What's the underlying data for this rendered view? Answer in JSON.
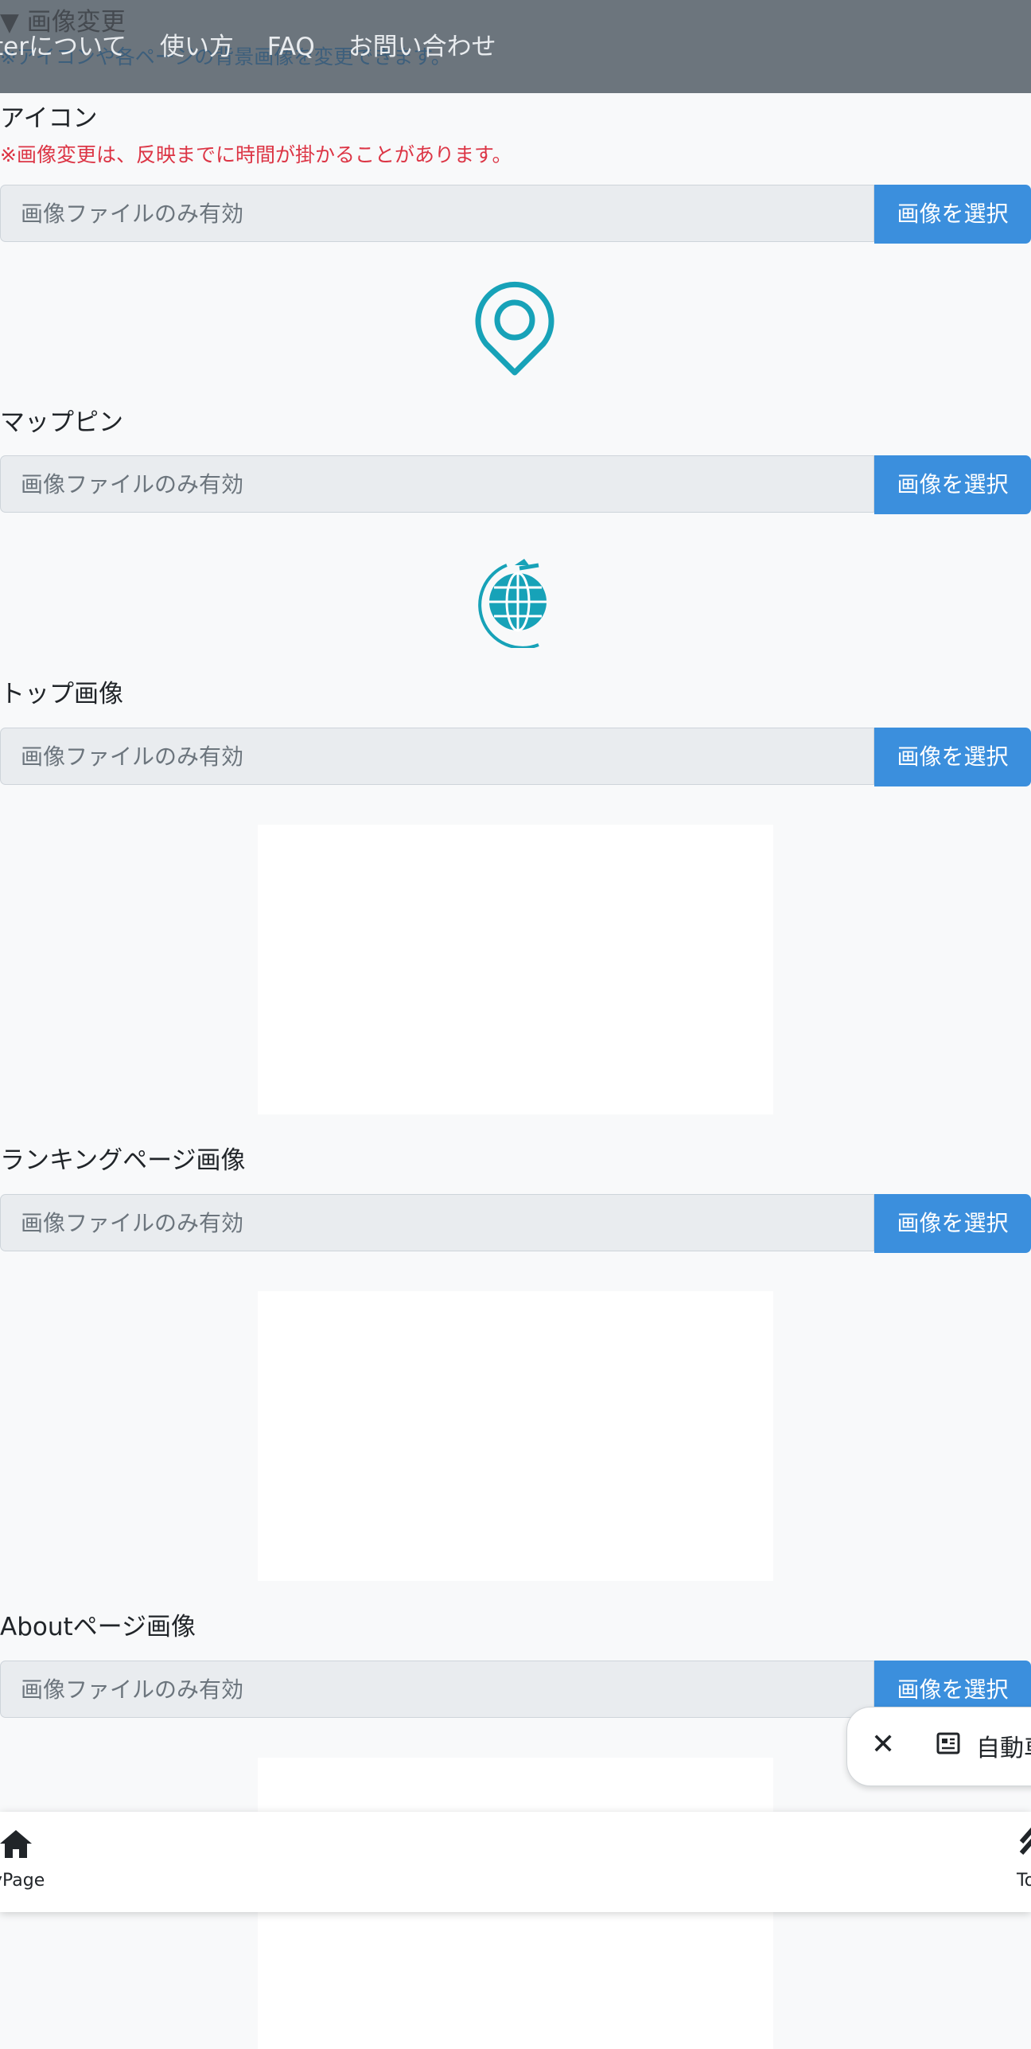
{
  "header": {
    "section_toggle": "▼ 画像変更",
    "section_description": "※アイコンや各ページの背景画像を変更できます。",
    "nav_items": [
      "terについて",
      "使い方",
      "FAQ",
      "お問い合わせ"
    ]
  },
  "warning": "※画像変更は、反映までに時間が掛かることがあります。",
  "sections": [
    {
      "label": "アイコン",
      "placeholder": "画像ファイルのみ有効",
      "button": "画像を選択",
      "preview": "map-pin-icon"
    },
    {
      "label": "マップピン",
      "placeholder": "画像ファイルのみ有効",
      "button": "画像を選択",
      "preview": "globe-icon"
    },
    {
      "label": "トップ画像",
      "placeholder": "画像ファイルのみ有効",
      "button": "画像を選択"
    },
    {
      "label": "ランキングページ画像",
      "placeholder": "画像ファイルのみ有効",
      "button": "画像を選択"
    },
    {
      "label": "Aboutページ画像",
      "placeholder": "画像ファイルのみ有効",
      "button": "画像を選択"
    }
  ],
  "floating_card": {
    "label": "自動車"
  },
  "bottom_nav": {
    "items": [
      {
        "label": "yPage",
        "icon": "home-icon"
      },
      {
        "label": "To",
        "icon": "partial-icon"
      }
    ]
  },
  "colors": {
    "accent": "#3b8fdd",
    "warning": "#dc3545",
    "icon": "#17a2b8",
    "header": "#6c757d"
  }
}
